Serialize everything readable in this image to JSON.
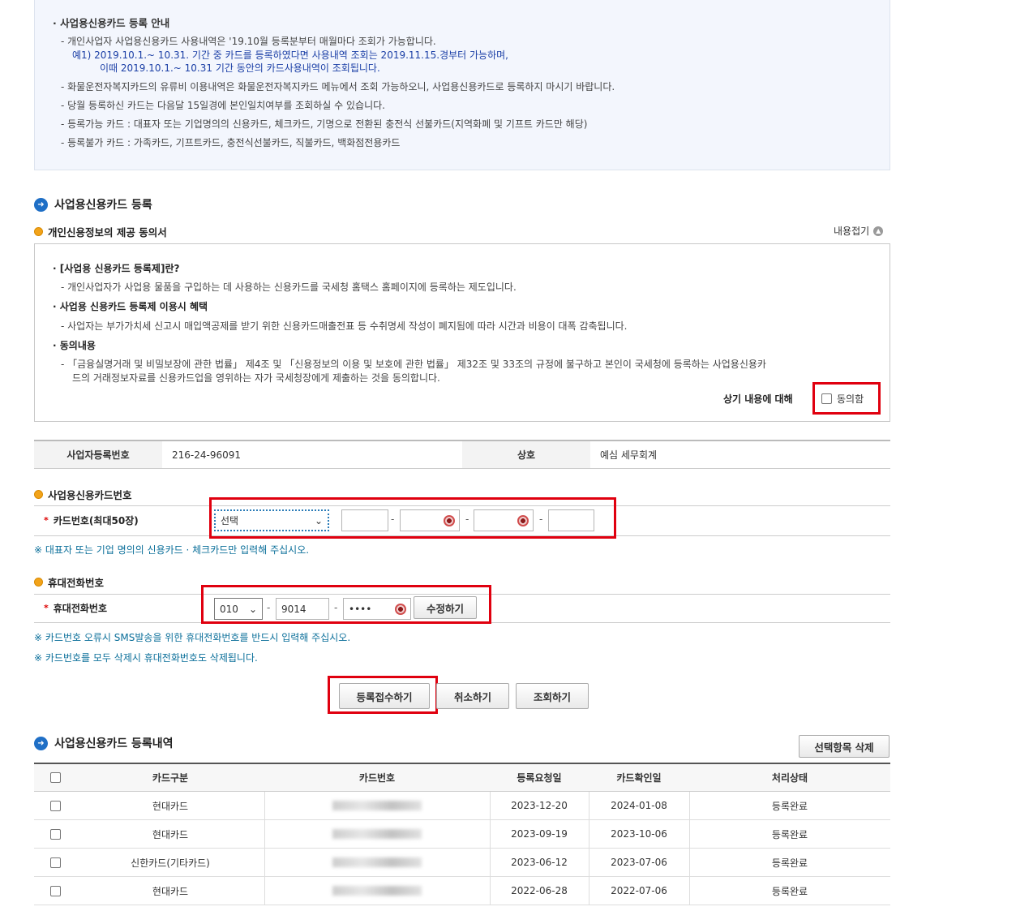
{
  "info": {
    "title": "· 사업용신용카드 등록 안내",
    "lines": [
      "- 개인사업자 사업용신용카드 사용내역은 '19.10월 등록분부터 매월마다 조회가 가능합니다.",
      "예1) 2019.10.1.~ 10.31. 기간 중 카드를 등록하였다면 사용내역 조회는 2019.11.15.경부터 가능하며,",
      "이때 2019.10.1.~ 10.31 기간 동안의 카드사용내역이 조회됩니다.",
      "- 화물운전자복지카드의 유류비 이용내역은 화물운전자복지카드 메뉴에서 조회 가능하오니, 사업용신용카드로 등록하지 마시기 바랍니다.",
      "- 당월 등록하신 카드는 다음달 15일경에 본인일치여부를 조회하실 수 있습니다.",
      "- 등록가능 카드 : 대표자 또는 기업명의의 신용카드, 체크카드, 기명으로 전환된 충전식 선불카드(지역화폐 및 기프트 카드만 해당)",
      "- 등록불가 카드 : 가족카드, 기프트카드, 충전식선불카드, 직불카드, 백화점전용카드"
    ]
  },
  "register": {
    "title": "사업용신용카드 등록",
    "consent_title": "개인신용정보의 제공 동의서",
    "fold_label": "내용접기",
    "consent_lines": [
      "· [사업용 신용카드 등록제]란?",
      "- 개인사업자가 사업용 물품을 구입하는 데 사용하는 신용카드를 국세청 홈택스 홈페이지에 등록하는 제도입니다.",
      "· 사업용 신용카드 등록제 이용시 혜택",
      "- 사업자는 부가가치세 신고시 매입액공제를 받기 위한 신용카드매출전표 등 수취명세 작성이 폐지됨에 따라 시간과 비용이 대폭 감축됩니다.",
      "· 동의내용",
      "- 「금융실명거래 및 비밀보장에 관한 법률」 제4조 및 「신용정보의 이용 및 보호에 관한 법률」 제32조 및 33조의 규정에 불구하고 본인이 국세청에 등록하는 사업용신용카",
      "드의   거래정보자료를 신용카드업을 영위하는 자가 국세청장에게 제출하는 것을 동의합니다."
    ],
    "agree_prefix": "상기 내용에 대해",
    "agree_label": "동의함",
    "biz_no_label": "사업자등록번호",
    "biz_no_value": "216-24-96091",
    "company_label": "상호",
    "company_value": "예심 세무회계",
    "card_section": "사업용신용카드번호",
    "card_label": "카드번호(최대50장)",
    "card_select": "선택",
    "card_note": "※ 대표자 또는 기업 명의의 신용카드 · 체크카드만 입력해 주십시오.",
    "phone_section": "휴대전화번호",
    "phone_label": "휴대전화번호",
    "phone_prefix": "010",
    "phone_mid": "9014",
    "phone_last": "••••",
    "modify_button": "수정하기",
    "phone_note1": "※ 카드번호 오류시 SMS발송을 위한 휴대전화번호를 반드시 입력해 주십시오.",
    "phone_note2": "※ 카드번호를 모두 삭제시 휴대전화번호도 삭제됩니다.",
    "submit_button": "등록접수하기",
    "cancel_button": "취소하기",
    "search_button": "조회하기"
  },
  "history": {
    "title": "사업용신용카드 등록내역",
    "delete_button": "선택항목 삭제",
    "columns": [
      "카드구분",
      "카드번호",
      "등록요청일",
      "카드확인일",
      "처리상태"
    ],
    "rows": [
      {
        "type": "현대카드",
        "req": "2023-12-20",
        "conf": "2024-01-08",
        "status": "등록완료"
      },
      {
        "type": "현대카드",
        "req": "2023-09-19",
        "conf": "2023-10-06",
        "status": "등록완료"
      },
      {
        "type": "신한카드(기타카드)",
        "req": "2023-06-12",
        "conf": "2023-07-06",
        "status": "등록완료"
      },
      {
        "type": "현대카드",
        "req": "2022-06-28",
        "conf": "2022-07-06",
        "status": "등록완료"
      }
    ]
  },
  "colors": {
    "highlight": "#e0000f",
    "accent": "#1f6fc6",
    "note": "#0b6f9a"
  }
}
